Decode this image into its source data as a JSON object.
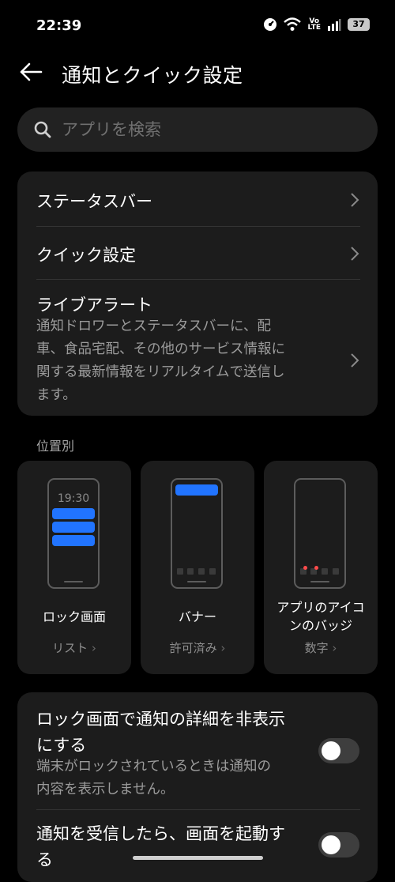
{
  "status_bar": {
    "time": "22:39",
    "network_top": "Vo",
    "network_bottom": "LTE",
    "battery": "37"
  },
  "header": {
    "title": "通知とクイック設定"
  },
  "search": {
    "placeholder": "アプリを検索"
  },
  "settings": {
    "status_bar_label": "ステータスバー",
    "quick_settings_label": "クイック設定",
    "live_alert_label": "ライブアラート",
    "live_alert_desc": [
      "通知ドロワーとステータスバーに、配",
      "車、食品宅配、その他のサービス情報に",
      "関する最新情報をリアルタイムで送信し",
      "ます。"
    ]
  },
  "section_label": "位置別",
  "tiles": [
    {
      "label": "ロック画面",
      "value": "リスト",
      "clock": "19:30"
    },
    {
      "label": "バナー",
      "value": "許可済み"
    },
    {
      "label_lines": [
        "アプリのアイコ",
        "ンのバッジ"
      ],
      "value": "数字"
    }
  ],
  "toggles": [
    {
      "title_lines": [
        "ロック画面で通知の詳細を非表示",
        "にする"
      ],
      "desc_lines": [
        "端末がロックされているときは通知の",
        "内容を表示しません。"
      ],
      "on": false
    },
    {
      "title_lines": [
        "通知を受信したら、画面を起動す",
        "る"
      ],
      "on": false
    }
  ],
  "colors": {
    "accent": "#2174ff",
    "badge": "#ff4b4b",
    "card": "#1c1c1c",
    "background": "#000000"
  }
}
